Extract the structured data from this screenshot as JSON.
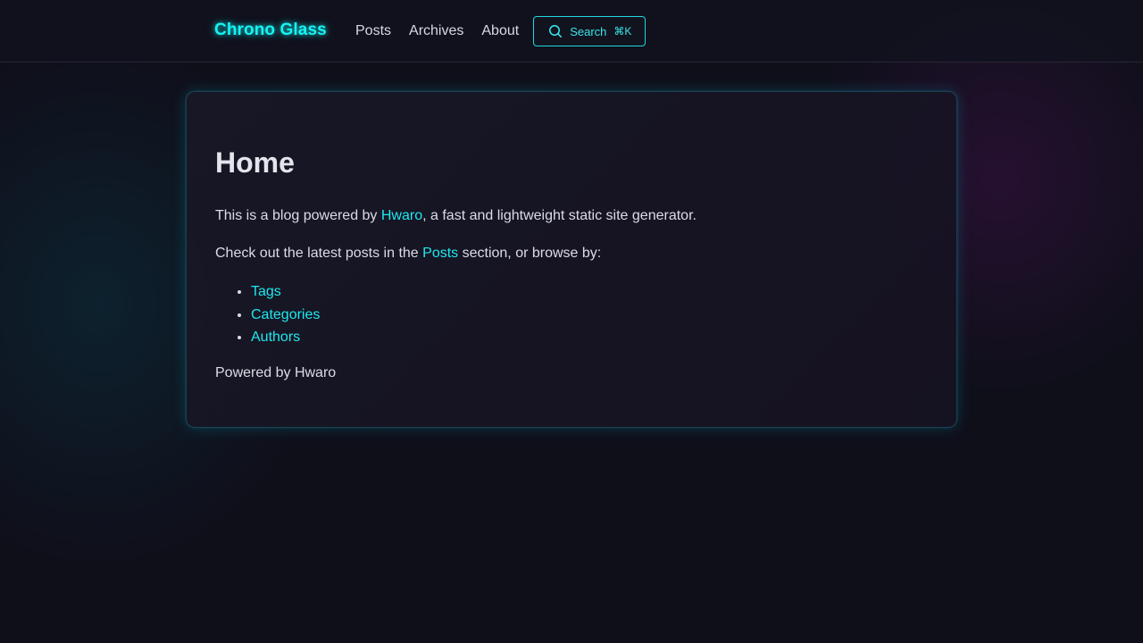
{
  "header": {
    "brand": "Chrono Glass",
    "nav": [
      {
        "label": "Posts"
      },
      {
        "label": "Archives"
      },
      {
        "label": "About"
      }
    ],
    "search": {
      "label": "Search",
      "shortcut": "⌘K",
      "icon": "search-icon"
    }
  },
  "main": {
    "title": "Home",
    "intro": {
      "before": "This is a blog powered by ",
      "link": "Hwaro",
      "after": ", a fast and lightweight static site generator."
    },
    "browse": {
      "before": "Check out the latest posts in the ",
      "link": "Posts",
      "after": " section, or browse by:"
    },
    "list": [
      {
        "label": "Tags"
      },
      {
        "label": "Categories"
      },
      {
        "label": "Authors"
      }
    ],
    "footer_text": "Powered by Hwaro"
  },
  "colors": {
    "accent": "#1ee8ee",
    "background": "#0f0f1a",
    "text": "#dcdce6"
  }
}
